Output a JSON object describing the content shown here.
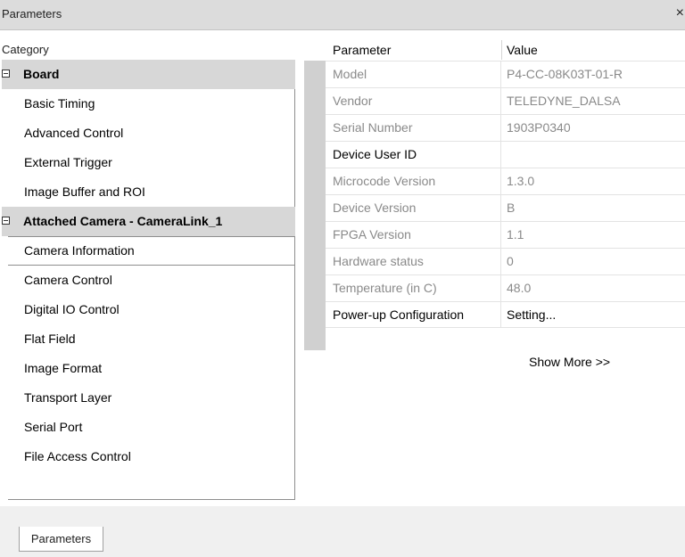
{
  "window": {
    "title": "Parameters",
    "close_glyph": "×"
  },
  "categories": {
    "header": "Category",
    "items": [
      {
        "label": "Board",
        "type": "group"
      },
      {
        "label": "Basic Timing",
        "type": "item"
      },
      {
        "label": "Advanced Control",
        "type": "item"
      },
      {
        "label": "External Trigger",
        "type": "item"
      },
      {
        "label": "Image Buffer and ROI",
        "type": "item"
      },
      {
        "label": "Attached Camera - CameraLink_1",
        "type": "group"
      },
      {
        "label": "Camera Information",
        "type": "item",
        "selected": true
      },
      {
        "label": "Camera Control",
        "type": "item"
      },
      {
        "label": "Digital IO Control",
        "type": "item"
      },
      {
        "label": "Flat Field",
        "type": "item"
      },
      {
        "label": "Image Format",
        "type": "item"
      },
      {
        "label": "Transport Layer",
        "type": "item"
      },
      {
        "label": "Serial Port",
        "type": "item"
      },
      {
        "label": "File Access Control",
        "type": "item"
      }
    ]
  },
  "grid": {
    "header_parameter": "Parameter",
    "header_value": "Value",
    "rows": [
      {
        "name": "Model",
        "value": "P4-CC-08K03T-01-R",
        "readonly": true
      },
      {
        "name": "Vendor",
        "value": "TELEDYNE_DALSA",
        "readonly": true
      },
      {
        "name": "Serial Number",
        "value": "1903P0340",
        "readonly": true
      },
      {
        "name": "Device User ID",
        "value": "",
        "readonly": false
      },
      {
        "name": "Microcode Version",
        "value": "1.3.0",
        "readonly": true
      },
      {
        "name": "Device Version",
        "value": "B",
        "readonly": true
      },
      {
        "name": "FPGA Version",
        "value": "1.1",
        "readonly": true
      },
      {
        "name": "Hardware status",
        "value": "0",
        "readonly": true
      },
      {
        "name": "Temperature (in C)",
        "value": "48.0",
        "readonly": true
      },
      {
        "name": "Power-up Configuration",
        "value": "Setting...",
        "readonly": false
      }
    ],
    "show_more": "Show More >>"
  },
  "tabs": {
    "parameters": "Parameters"
  }
}
